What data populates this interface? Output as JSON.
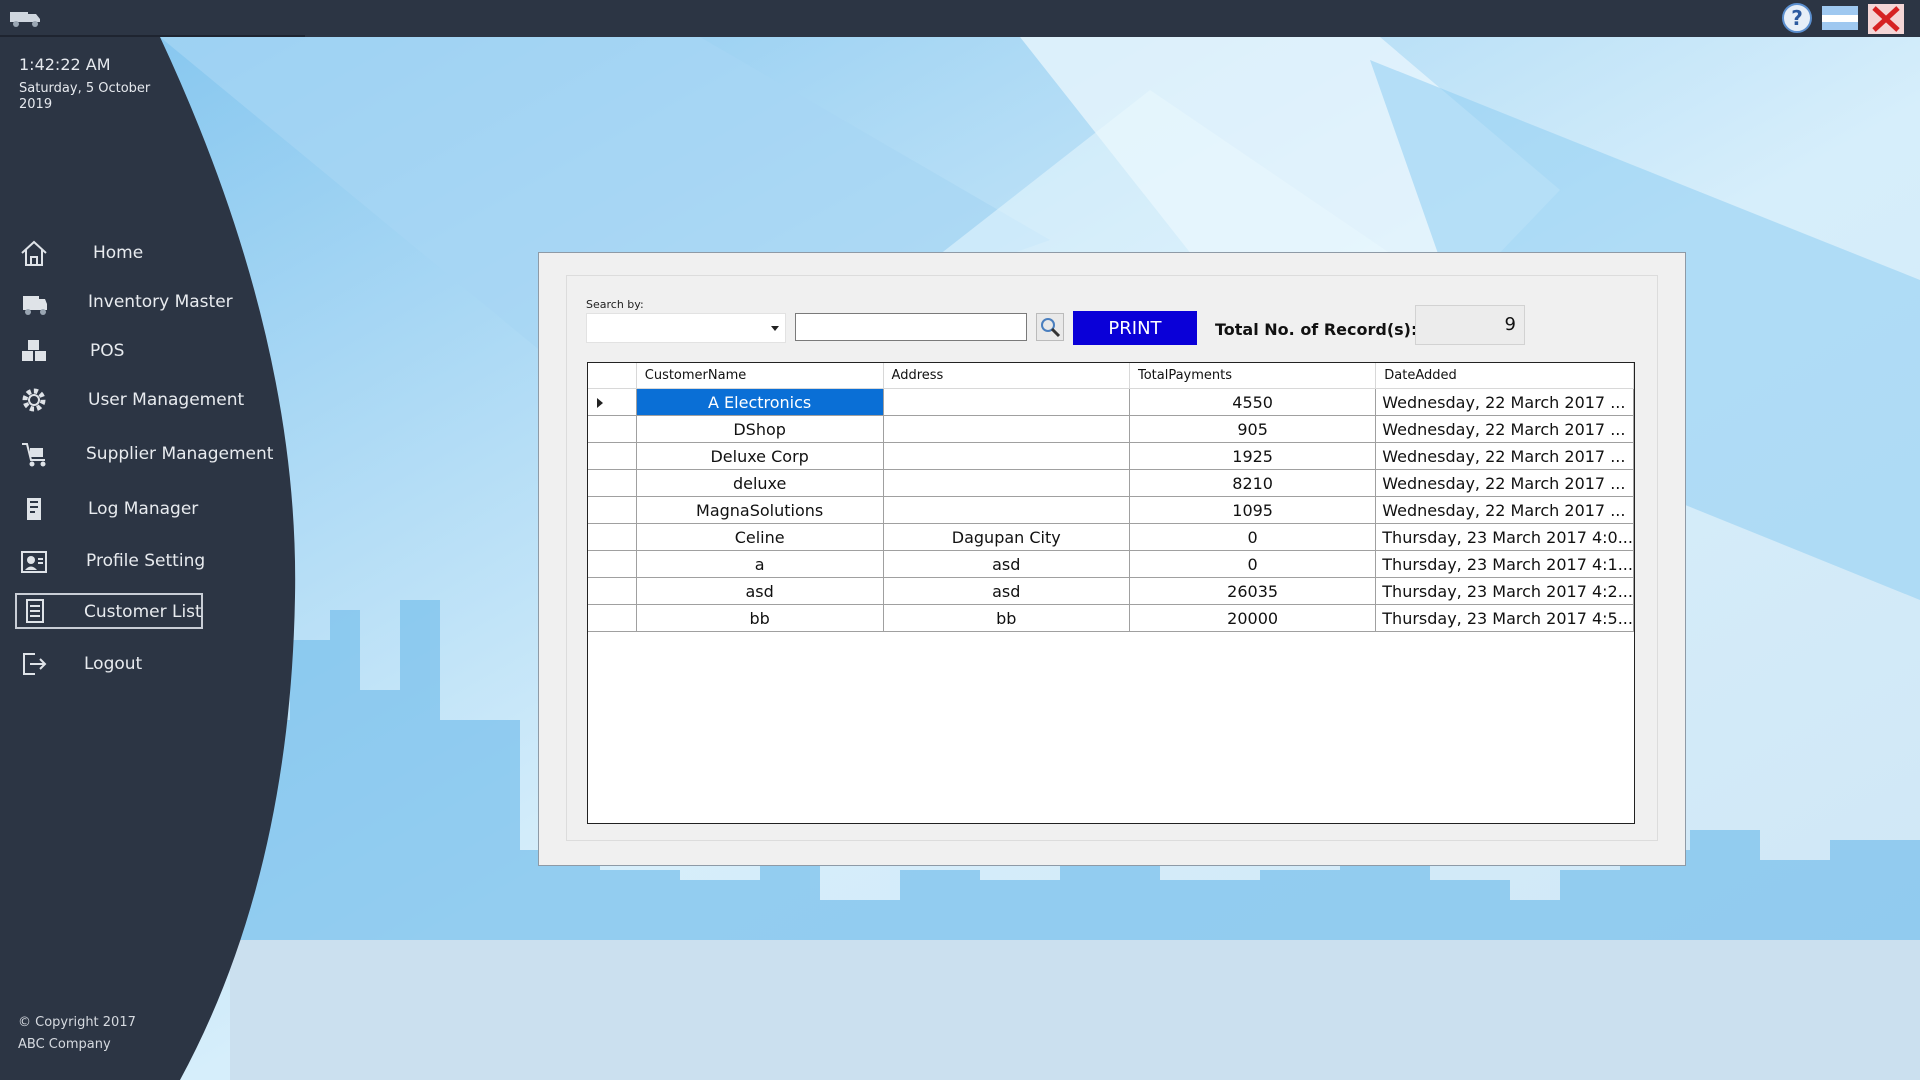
{
  "window": {
    "icons": {
      "app": "truck-icon",
      "help": "help-icon",
      "minimize": "minimize-icon",
      "close": "close-icon"
    }
  },
  "clock": {
    "time": "1:42:22 AM",
    "date": "Saturday, 5 October 2019"
  },
  "sidebar": {
    "items": [
      {
        "label": "Home",
        "icon": "home-icon"
      },
      {
        "label": "Inventory Master",
        "icon": "inventory-icon"
      },
      {
        "label": "POS",
        "icon": "pos-icon"
      },
      {
        "label": "User Management",
        "icon": "gear-icon"
      },
      {
        "label": "Supplier Management",
        "icon": "supplier-icon"
      },
      {
        "label": "Log Manager",
        "icon": "log-icon"
      },
      {
        "label": "Profile Setting",
        "icon": "profile-icon"
      },
      {
        "label": "Customer List",
        "icon": "customer-list-icon",
        "active": true
      },
      {
        "label": "Logout",
        "icon": "logout-icon"
      }
    ],
    "copyright": [
      "© Copyright 2017",
      "ABC Company"
    ]
  },
  "toolbar": {
    "search_label": "Search by:",
    "search_by_value": "",
    "search_text": "",
    "print_label": "PRINT",
    "total_label": "Total No. of Record(s):",
    "total_value": "9"
  },
  "grid": {
    "columns": [
      "CustomerName",
      "Address",
      "TotalPayments",
      "DateAdded"
    ],
    "selected_row": 0,
    "rows": [
      [
        "A Electronics",
        "",
        "4550",
        "Wednesday, 22 March 2017 ..."
      ],
      [
        "DShop",
        "",
        "905",
        "Wednesday, 22 March 2017 ..."
      ],
      [
        "Deluxe Corp",
        "",
        "1925",
        "Wednesday, 22 March 2017 ..."
      ],
      [
        "deluxe",
        "",
        "8210",
        "Wednesday, 22 March 2017 ..."
      ],
      [
        "MagnaSolutions",
        "",
        "1095",
        "Wednesday, 22 March 2017 ..."
      ],
      [
        "Celine",
        "Dagupan City",
        "0",
        "Thursday, 23 March 2017 4:0..."
      ],
      [
        "a",
        "asd",
        "0",
        "Thursday, 23 March 2017 4:1..."
      ],
      [
        "asd",
        "asd",
        "26035",
        "Thursday, 23 March 2017 4:2..."
      ],
      [
        "bb",
        "bb",
        "20000",
        "Thursday, 23 March 2017 4:5..."
      ]
    ]
  },
  "colors": {
    "sidebar": "#2c3544",
    "titlebar": "#2c3544",
    "print_button": "#0a00d8",
    "selection": "#0a6fd6"
  }
}
